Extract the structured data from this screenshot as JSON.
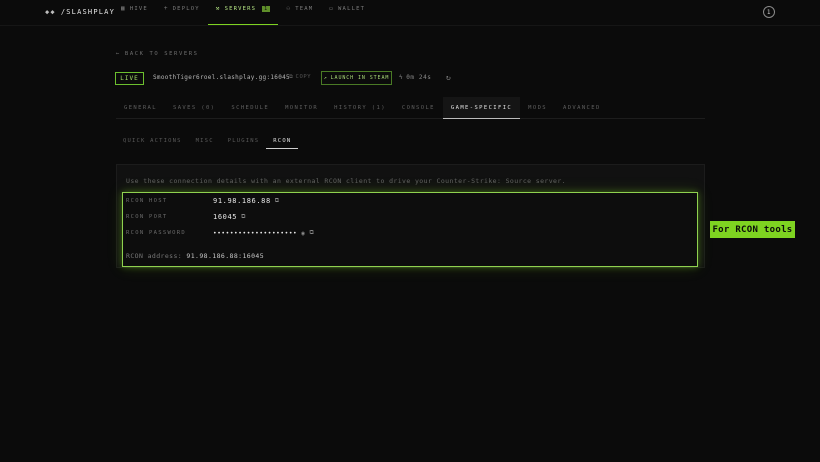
{
  "brand": {
    "logo_mark": "◆◆",
    "name": "/SLASHPLAY"
  },
  "nav": [
    {
      "icon": "hive-icon",
      "glyph": "▦",
      "label": "HIVE",
      "active": false
    },
    {
      "icon": "deploy-icon",
      "glyph": "+",
      "label": "DEPLOY",
      "active": false
    },
    {
      "icon": "servers-icon",
      "glyph": "⚒",
      "label": "SERVERS",
      "active": true,
      "badge": "1"
    },
    {
      "icon": "team-icon",
      "glyph": "⚇",
      "label": "TEAM",
      "active": false
    },
    {
      "icon": "wallet-icon",
      "glyph": "▭",
      "label": "WALLET",
      "active": false
    }
  ],
  "avatar": "1",
  "back": {
    "glyph": "←",
    "label": "BACK TO SERVERS"
  },
  "server": {
    "status": "LIVE",
    "address": "SmoothTiger6roel.slashplay.gg:16045",
    "copy_label": "COPY",
    "launch_label": "LAUNCH IN STEAM",
    "uptime": "0m 24s"
  },
  "tabs": [
    "GENERAL",
    "SAVES (0)",
    "SCHEDULE",
    "MONITOR",
    "HISTORY (1)",
    "CONSOLE",
    "GAME-SPECIFIC",
    "MODS",
    "ADVANCED"
  ],
  "active_tab": "GAME-SPECIFIC",
  "subtabs": [
    "QUICK ACTIONS",
    "MISC",
    "PLUGINS",
    "RCON"
  ],
  "active_subtab": "RCON",
  "rcon": {
    "description": "Use these connection details with an external RCON client to drive your Counter-Strike: Source server.",
    "host_label": "RCON HOST",
    "host_value": "91.98.186.88",
    "port_label": "RCON PORT",
    "port_value": "16045",
    "password_label": "RCON PASSWORD",
    "password_value": "••••••••••••••••••••",
    "address_label": "RCON address:",
    "address_value": "91.98.186.88:16045"
  },
  "tooltip": "For RCON tools",
  "colors": {
    "accent": "#7ed321",
    "background": "#0b0b0b",
    "panel": "#111111"
  }
}
